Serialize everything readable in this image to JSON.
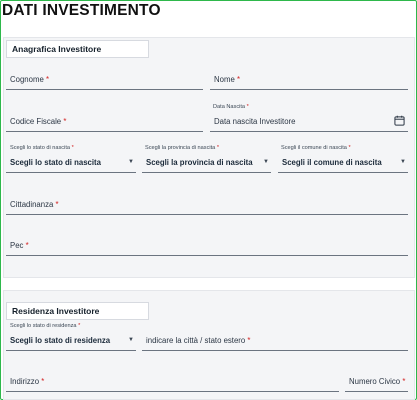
{
  "page_title": "DATI INVESTIMENTO",
  "anagrafica": {
    "section_title": "Anagrafica Investitore",
    "cognome_label": "Cognome",
    "nome_label": "Nome",
    "codice_fiscale_label": "Codice Fiscale",
    "data_nascita_label": "Data Nascita",
    "data_nascita_placeholder": "Data nascita Investitore",
    "stato_nascita_label": "Scegli lo stato di nascita",
    "stato_nascita_value": "Scegli lo stato di nascita",
    "provincia_nascita_label": "Scegli la provincia di nascita",
    "provincia_nascita_value": "Scegli la provincia di nascita",
    "comune_nascita_label": "Scegli il comune di nascita",
    "comune_nascita_value": "Scegli il comune di nascita",
    "cittadinanza_label": "Cittadinanza",
    "pec_label": "Pec"
  },
  "residenza": {
    "section_title": "Residenza Investitore",
    "stato_residenza_label": "Scegli lo stato di residenza",
    "stato_residenza_value": "Scegli lo stato di residenza",
    "citta_label": "indicare la città / stato estero",
    "indirizzo_label": "Indirizzo",
    "numero_civico_label": "Numero Civico"
  },
  "required_marker": "*",
  "icons": {
    "calendar": "calendar-icon",
    "dropdown": "chevron-down-icon"
  },
  "colors": {
    "border_accent": "#2eb84b",
    "required": "#d21f1f",
    "section_bg": "#f4f5f7"
  }
}
